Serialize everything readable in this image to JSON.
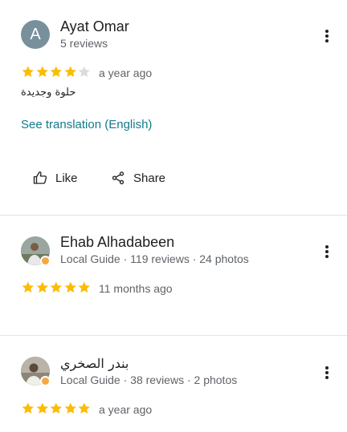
{
  "reviews": [
    {
      "avatar_letter": "A",
      "name": "Ayat Omar",
      "meta": "5 reviews",
      "rating": 4,
      "date": "a year ago",
      "text": "حلوة وجديدة",
      "translate_label": "See translation (English)",
      "like_label": "Like",
      "share_label": "Share"
    },
    {
      "name": "Ehab Alhadabeen",
      "meta": "Local Guide · 119 reviews · 24 photos",
      "rating": 5,
      "date": "11 months ago"
    },
    {
      "name": "بندر الصخري",
      "meta": "Local Guide · 38 reviews · 2 photos",
      "rating": 5,
      "date": "a year ago"
    }
  ],
  "colors": {
    "star_filled": "#fbbc04",
    "star_empty": "#dadce0",
    "link": "#137b8c",
    "avatar_bg": "#78909c",
    "guide_badge": "#f5a742"
  }
}
